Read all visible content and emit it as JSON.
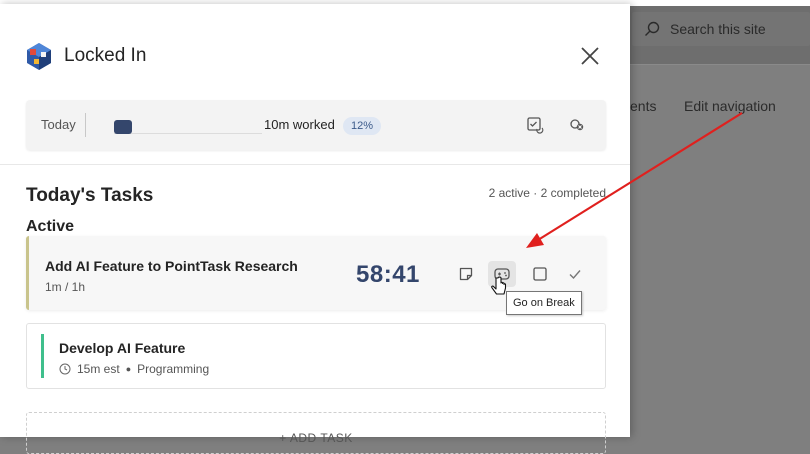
{
  "background": {
    "search_placeholder": "Search this site",
    "nav_partial": "ents",
    "nav_edit": "Edit navigation"
  },
  "panel": {
    "title": "Locked In"
  },
  "today_bar": {
    "label": "Today",
    "progress_fraction": 0.12,
    "worked": "10m worked",
    "percent": "12%"
  },
  "tasks": {
    "heading": "Today's Tasks",
    "counts": "2 active · 2 completed",
    "active_heading": "Active",
    "items": [
      {
        "name": "Add AI Feature to PointTask Research",
        "meta": "1m / 1h",
        "timer": "58:41"
      },
      {
        "name": "Develop AI Feature",
        "estimate": "15m est",
        "category": "Programming"
      }
    ],
    "add_task": "+ ADD TASK"
  },
  "tooltip": {
    "text": "Go on Break"
  },
  "colors": {
    "accent": "#34466c",
    "active_border": "#c9c48c",
    "task_accent": "#3fbf8c",
    "annotation_arrow": "#e0201e"
  }
}
